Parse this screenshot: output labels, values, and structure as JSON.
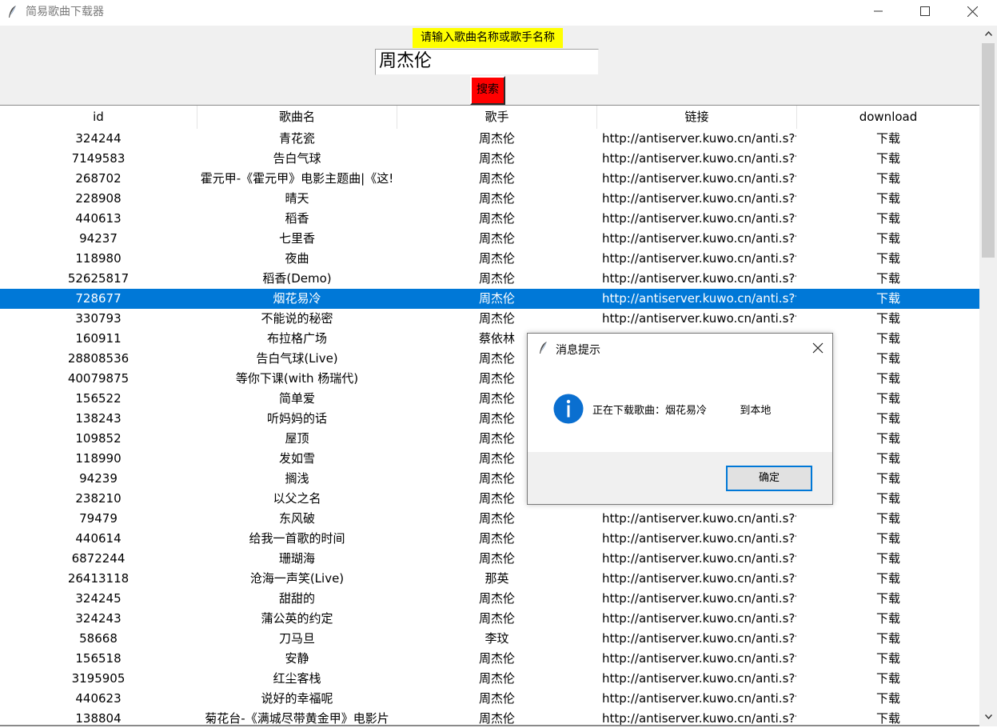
{
  "window": {
    "title": "简易歌曲下载器"
  },
  "search": {
    "prompt": "请输入歌曲名称或歌手名称",
    "value": "周杰伦",
    "button_label": "搜索"
  },
  "table": {
    "columns": [
      "id",
      "歌曲名",
      "歌手",
      "链接",
      "download"
    ],
    "selected_index": 8,
    "rows": [
      {
        "id": "324244",
        "name": "青花瓷",
        "artist": "周杰伦",
        "link": "http://antiserver.kuwo.cn/anti.s?fc",
        "download": "下载"
      },
      {
        "id": "7149583",
        "name": "告白气球",
        "artist": "周杰伦",
        "link": "http://antiserver.kuwo.cn/anti.s?fc",
        "download": "下载"
      },
      {
        "id": "268702",
        "name": "霍元甲-《霍元甲》电影主题曲|《这!",
        "artist": "周杰伦",
        "link": "http://antiserver.kuwo.cn/anti.s?fc",
        "download": "下载"
      },
      {
        "id": "228908",
        "name": "晴天",
        "artist": "周杰伦",
        "link": "http://antiserver.kuwo.cn/anti.s?fc",
        "download": "下载"
      },
      {
        "id": "440613",
        "name": "稻香",
        "artist": "周杰伦",
        "link": "http://antiserver.kuwo.cn/anti.s?fc",
        "download": "下载"
      },
      {
        "id": "94237",
        "name": "七里香",
        "artist": "周杰伦",
        "link": "http://antiserver.kuwo.cn/anti.s?fc",
        "download": "下载"
      },
      {
        "id": "118980",
        "name": "夜曲",
        "artist": "周杰伦",
        "link": "http://antiserver.kuwo.cn/anti.s?fc",
        "download": "下载"
      },
      {
        "id": "52625817",
        "name": "稻香(Demo)",
        "artist": "周杰伦",
        "link": "http://antiserver.kuwo.cn/anti.s?fc",
        "download": "下载"
      },
      {
        "id": "728677",
        "name": "烟花易冷",
        "artist": "周杰伦",
        "link": "http://antiserver.kuwo.cn/anti.s?fc",
        "download": "下载"
      },
      {
        "id": "330793",
        "name": "不能说的秘密",
        "artist": "周杰伦",
        "link": "http://antiserver.kuwo.cn/anti.s?fc",
        "download": "下载"
      },
      {
        "id": "160911",
        "name": "布拉格广场",
        "artist": "蔡依林",
        "link": "",
        "download": "下载"
      },
      {
        "id": "28808536",
        "name": "告白气球(Live)",
        "artist": "周杰伦",
        "link": "",
        "download": "下载"
      },
      {
        "id": "40079875",
        "name": "等你下课(with 杨瑞代)",
        "artist": "周杰伦",
        "link": "",
        "download": "下载"
      },
      {
        "id": "156522",
        "name": "简单爱",
        "artist": "周杰伦",
        "link": "",
        "download": "下载"
      },
      {
        "id": "138243",
        "name": "听妈妈的话",
        "artist": "周杰伦",
        "link": "",
        "download": "下载"
      },
      {
        "id": "109852",
        "name": "屋顶",
        "artist": "周杰伦",
        "link": "",
        "download": "下载"
      },
      {
        "id": "118990",
        "name": "发如雪",
        "artist": "周杰伦",
        "link": "",
        "download": "下载"
      },
      {
        "id": "94239",
        "name": "搁浅",
        "artist": "周杰伦",
        "link": "",
        "download": "下载"
      },
      {
        "id": "238210",
        "name": "以父之名",
        "artist": "周杰伦",
        "link": "",
        "download": "下载"
      },
      {
        "id": "79479",
        "name": "东风破",
        "artist": "周杰伦",
        "link": "http://antiserver.kuwo.cn/anti.s?fc",
        "download": "下载"
      },
      {
        "id": "440614",
        "name": "给我一首歌的时间",
        "artist": "周杰伦",
        "link": "http://antiserver.kuwo.cn/anti.s?fc",
        "download": "下载"
      },
      {
        "id": "6872244",
        "name": "珊瑚海",
        "artist": "周杰伦",
        "link": "http://antiserver.kuwo.cn/anti.s?fc",
        "download": "下载"
      },
      {
        "id": "26413118",
        "name": "沧海一声笑(Live)",
        "artist": "那英",
        "link": "http://antiserver.kuwo.cn/anti.s?fc",
        "download": "下载"
      },
      {
        "id": "324245",
        "name": "甜甜的",
        "artist": "周杰伦",
        "link": "http://antiserver.kuwo.cn/anti.s?fc",
        "download": "下载"
      },
      {
        "id": "324243",
        "name": "蒲公英的约定",
        "artist": "周杰伦",
        "link": "http://antiserver.kuwo.cn/anti.s?fc",
        "download": "下载"
      },
      {
        "id": "58668",
        "name": "刀马旦",
        "artist": "李玟",
        "link": "http://antiserver.kuwo.cn/anti.s?fc",
        "download": "下载"
      },
      {
        "id": "156518",
        "name": "安静",
        "artist": "周杰伦",
        "link": "http://antiserver.kuwo.cn/anti.s?fc",
        "download": "下载"
      },
      {
        "id": "3195905",
        "name": "红尘客栈",
        "artist": "周杰伦",
        "link": "http://antiserver.kuwo.cn/anti.s?fc",
        "download": "下载"
      },
      {
        "id": "440623",
        "name": "说好的幸福呢",
        "artist": "周杰伦",
        "link": "http://antiserver.kuwo.cn/anti.s?fc",
        "download": "下载"
      },
      {
        "id": "138804",
        "name": "菊花台-《满城尽带黄金甲》电影片",
        "artist": "周杰伦",
        "link": "http://antiserver.kuwo.cn/anti.s?fc",
        "download": "下载"
      }
    ]
  },
  "dialog": {
    "title": "消息提示",
    "message": "正在下载歌曲：烟花易冷          到本地",
    "ok_label": "确定",
    "icon": "info-icon"
  },
  "colors": {
    "selection": "#0078d7",
    "prompt_bg": "#ffff00",
    "search_button_bg": "#ff0000"
  }
}
